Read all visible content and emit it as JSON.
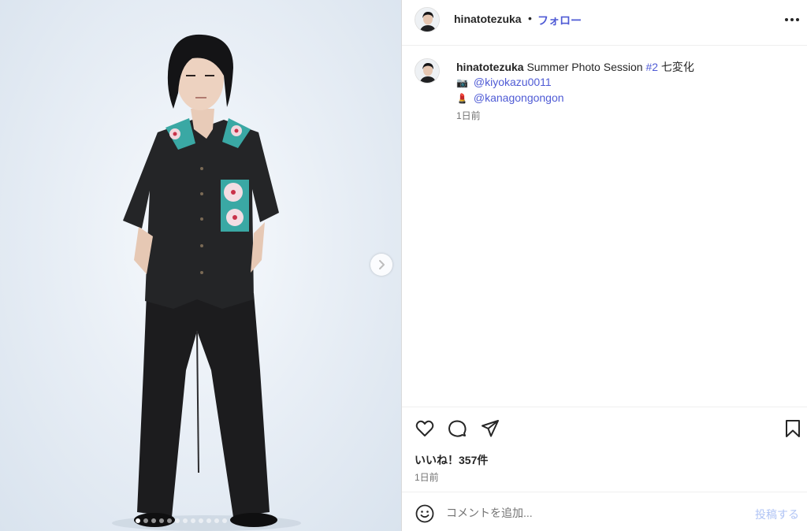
{
  "post": {
    "username": "hinatotezuka",
    "separator": "•",
    "follow_label": "フォロー",
    "caption": {
      "username": "hinatotezuka",
      "text": "Summer Photo Session ",
      "hashtag": "#2",
      "suffix": " 七変化",
      "line2_emoji": "📷",
      "line2_mention": "@kiyokazu0011",
      "line3_emoji": "💄",
      "line3_mention": "@kanagongongon",
      "time": "1日前"
    },
    "likes": "いいね！357件",
    "time": "1日前",
    "comment": {
      "placeholder": "コメントを追加...",
      "value": "",
      "post_label": "投稿する"
    }
  },
  "carousel": {
    "total": 12,
    "active_index": 0
  },
  "icons": {
    "more": "more-horizontal-icon",
    "next": "chevron-right-icon",
    "like": "heart-icon",
    "comment": "comment-icon",
    "share": "paper-plane-icon",
    "save": "bookmark-icon",
    "emoji": "smiley-icon"
  },
  "colors": {
    "link": "#4f5bd5",
    "text": "#262626",
    "muted": "#737373",
    "post_disabled": "#b0c4f5"
  }
}
